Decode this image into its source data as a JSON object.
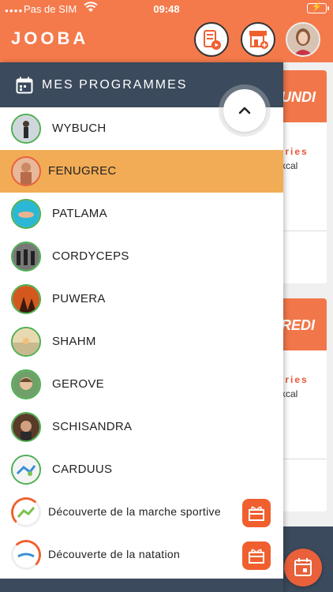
{
  "status": {
    "carrier": "Pas de SIM",
    "time": "09:48",
    "battery": "⚡"
  },
  "app": {
    "logo": "JOOBA"
  },
  "header_buttons": [
    {
      "icon": "program-video-icon"
    },
    {
      "icon": "shop-add-icon"
    },
    {
      "icon": "user-avatar"
    }
  ],
  "background": {
    "cards": [
      {
        "day": "UNDI",
        "calories": "ories",
        "kcal": "kcal"
      },
      {
        "day": "REDI",
        "calories": "ories",
        "kcal": "kcal"
      }
    ]
  },
  "drawer": {
    "title": "MES PROGRAMMES",
    "items": [
      {
        "label": "WYBUCH",
        "active": false
      },
      {
        "label": "FENUGREC",
        "active": true
      },
      {
        "label": "PATLAMA",
        "active": false
      },
      {
        "label": "CORDYCEPS",
        "active": false
      },
      {
        "label": "PUWERA",
        "active": false
      },
      {
        "label": "SHAHM",
        "active": false
      },
      {
        "label": "GEROVE",
        "active": false
      },
      {
        "label": "SCHISANDRA",
        "active": false
      },
      {
        "label": "CARDUUS",
        "active": false
      },
      {
        "label": "Découverte de la marche sportive",
        "active": false,
        "gift": true
      },
      {
        "label": "Découverte de la natation",
        "active": false,
        "gift": true
      }
    ]
  },
  "colors": {
    "accent": "#f47a4b",
    "dark": "#3b4a5c",
    "active": "#f2ac56",
    "ring": "#4caf50"
  }
}
